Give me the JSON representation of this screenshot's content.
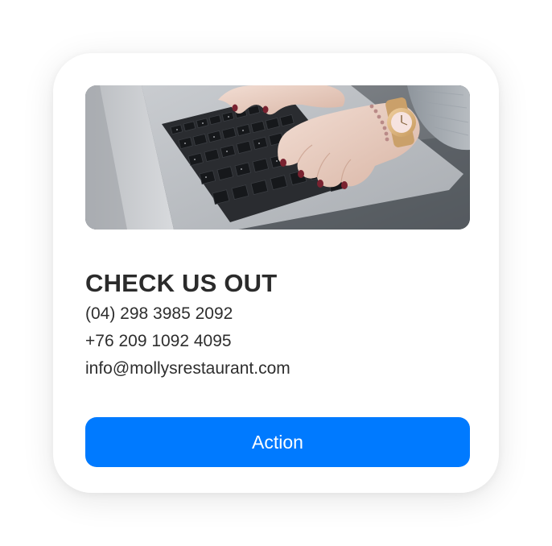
{
  "card": {
    "image_alt": "Hands typing on a laptop keyboard",
    "title": "CHECK US OUT",
    "phone_primary": "(04) 298 3985 2092",
    "phone_secondary": "+76 209 1092 4095",
    "email": "info@mollysrestaurant.com",
    "action_label": "Action"
  },
  "colors": {
    "button_bg": "#007aff",
    "button_text": "#ffffff",
    "title_text": "#2b2b2b",
    "body_text": "#2e2e2e",
    "card_bg": "#ffffff"
  }
}
